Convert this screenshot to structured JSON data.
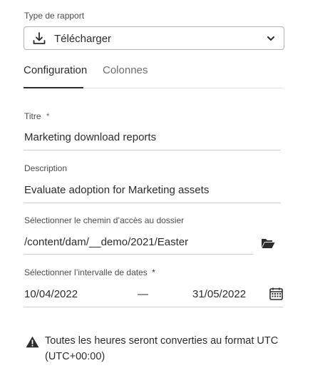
{
  "report_type": {
    "label": "Type de rapport",
    "selected": "Télécharger",
    "icon": "download-icon"
  },
  "tabs": [
    {
      "label": "Configuration",
      "active": true
    },
    {
      "label": "Colonnes",
      "active": false
    }
  ],
  "fields": {
    "title": {
      "label": "Titre",
      "required_marker": "*",
      "value": "Marketing download reports"
    },
    "description": {
      "label": "Description",
      "value": "Evaluate adoption for Marketing assets"
    },
    "folder": {
      "label": "Sélectionner le chemin d’accès au dossier",
      "value": "/content/dam/__demo/2021/Easter",
      "icon": "folder-open-icon"
    },
    "date_range": {
      "label": "Sélectionner l’intervalle de dates",
      "required_marker": "*",
      "start": "10/04/2022",
      "separator": "—",
      "end": "31/05/2022",
      "icon": "calendar-icon"
    }
  },
  "notice": {
    "icon": "alert-icon",
    "line1": "Toutes les heures seront converties au format UTC",
    "line2": "(UTC+00:00)"
  },
  "colors": {
    "text": "#2c2c2c",
    "border": "#b3b3b3",
    "underline": "#cfcfcf"
  }
}
